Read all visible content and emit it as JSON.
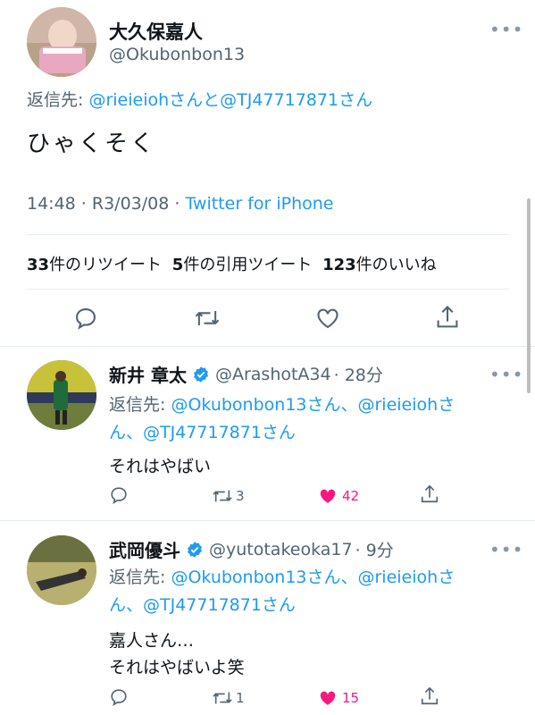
{
  "main_tweet": {
    "display_name": "大久保嘉人",
    "handle": "@Okubonbon13",
    "reply_prefix": "返信先: ",
    "reply_to": "@rieieiohさんと@TJ47717871さん",
    "text": "ひゃくそく",
    "time_date": "14:48 · R3/03/08 · ",
    "source": "Twitter for iPhone",
    "stats": {
      "retweets": "33",
      "retweets_label": "件のリツイート",
      "quotes": "5",
      "quotes_label": "件の引用ツイート",
      "likes": "123",
      "likes_label": "件のいいね"
    }
  },
  "replies": [
    {
      "display_name": "新井 章太",
      "handle": "@ArashotA34",
      "time": "· 28分",
      "reply_prefix": "返信先: ",
      "reply_line1": "@Okubonbon13さん、@rieieiohさ",
      "reply_line2": "ん、@TJ47717871さん",
      "text_line1": "それはやばい",
      "text_line2": "",
      "retweet_count": "3",
      "like_count": "42",
      "verified": true
    },
    {
      "display_name": "武岡優斗",
      "handle": "@yutotakeoka17",
      "time": "· 9分",
      "reply_prefix": "返信先: ",
      "reply_line1": "@Okubonbon13さん、@rieieiohさ",
      "reply_line2": "ん、@TJ47717871さん",
      "text_line1": "嘉人さん…",
      "text_line2": "それはやばいよ笑",
      "retweet_count": "1",
      "like_count": "15",
      "verified": true
    }
  ],
  "colors": {
    "accent": "#1d9bf0",
    "like": "#f91880",
    "text": "#0f1419",
    "muted": "#536471"
  },
  "icons": [
    "more-icon",
    "reply-icon",
    "retweet-icon",
    "like-icon",
    "share-icon",
    "verified-icon"
  ]
}
